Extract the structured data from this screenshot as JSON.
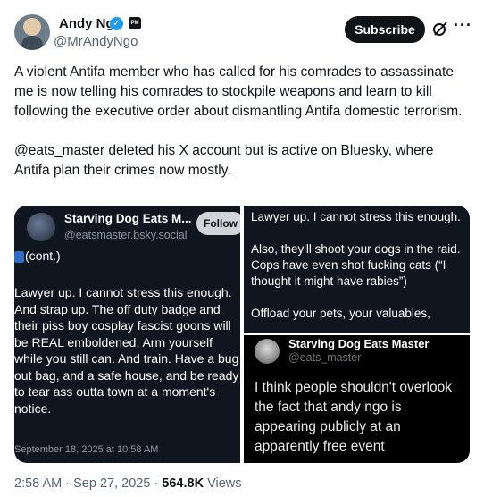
{
  "author": {
    "name": "Andy Ngo",
    "handle": "@MrAndyNgo",
    "affiliate_badge": "PM"
  },
  "actions": {
    "subscribe_label": "Subscribe",
    "more_label": "···"
  },
  "tweet": {
    "paragraphs": [
      "A violent Antifa member who has called for his comrades to assassinate me is now telling his comrades to stockpile weapons and learn to kill following the executive order about dismantling Antifa domestic terrorism.",
      "@eats_master deleted his X account but is active on Bluesky, where Antifa plan their crimes now mostly."
    ]
  },
  "media": {
    "bluesky_post": {
      "name": "Starving Dog Eats M...",
      "handle": "@eatsmaster.bsky.social",
      "follow_label": "Follow",
      "cont": "(cont.)",
      "body": "Lawyer up. I cannot stress this enough. And strap up. The off duty badge and their piss boy cosplay fascist goons will be REAL emboldened. Arm yourself while you still can. And train. Have a bug out bag, and a safe house, and be ready to tear ass outta town at a moment's notice.",
      "date": "September 18, 2025 at 10:58 AM"
    },
    "bluesky_continuation": {
      "paragraphs": [
        "Lawyer up. I cannot stress this enough.",
        "Also, they'll shoot your dogs in the raid. Cops have even shot fucking cats (“I thought it might have rabies”)",
        "Offload your pets, your valuables,"
      ]
    },
    "x_post": {
      "name": "Starving Dog Eats Master",
      "handle": "@eats_master",
      "body": "I think people shouldn't overlook the fact that andy ngo is appearing publicly at an apparently free event"
    }
  },
  "meta": {
    "time": "2:58 AM",
    "separator": "·",
    "date": "Sep 27, 2025",
    "views_count": "564.8K",
    "views_label": "Views"
  },
  "colors": {
    "verified": "#1d9bf0",
    "pane_dark": "#10161f",
    "subscribe_bg": "#0f1419"
  },
  "icons": [
    "verified-icon",
    "grok-icon",
    "more-icon",
    "thread-icon"
  ]
}
